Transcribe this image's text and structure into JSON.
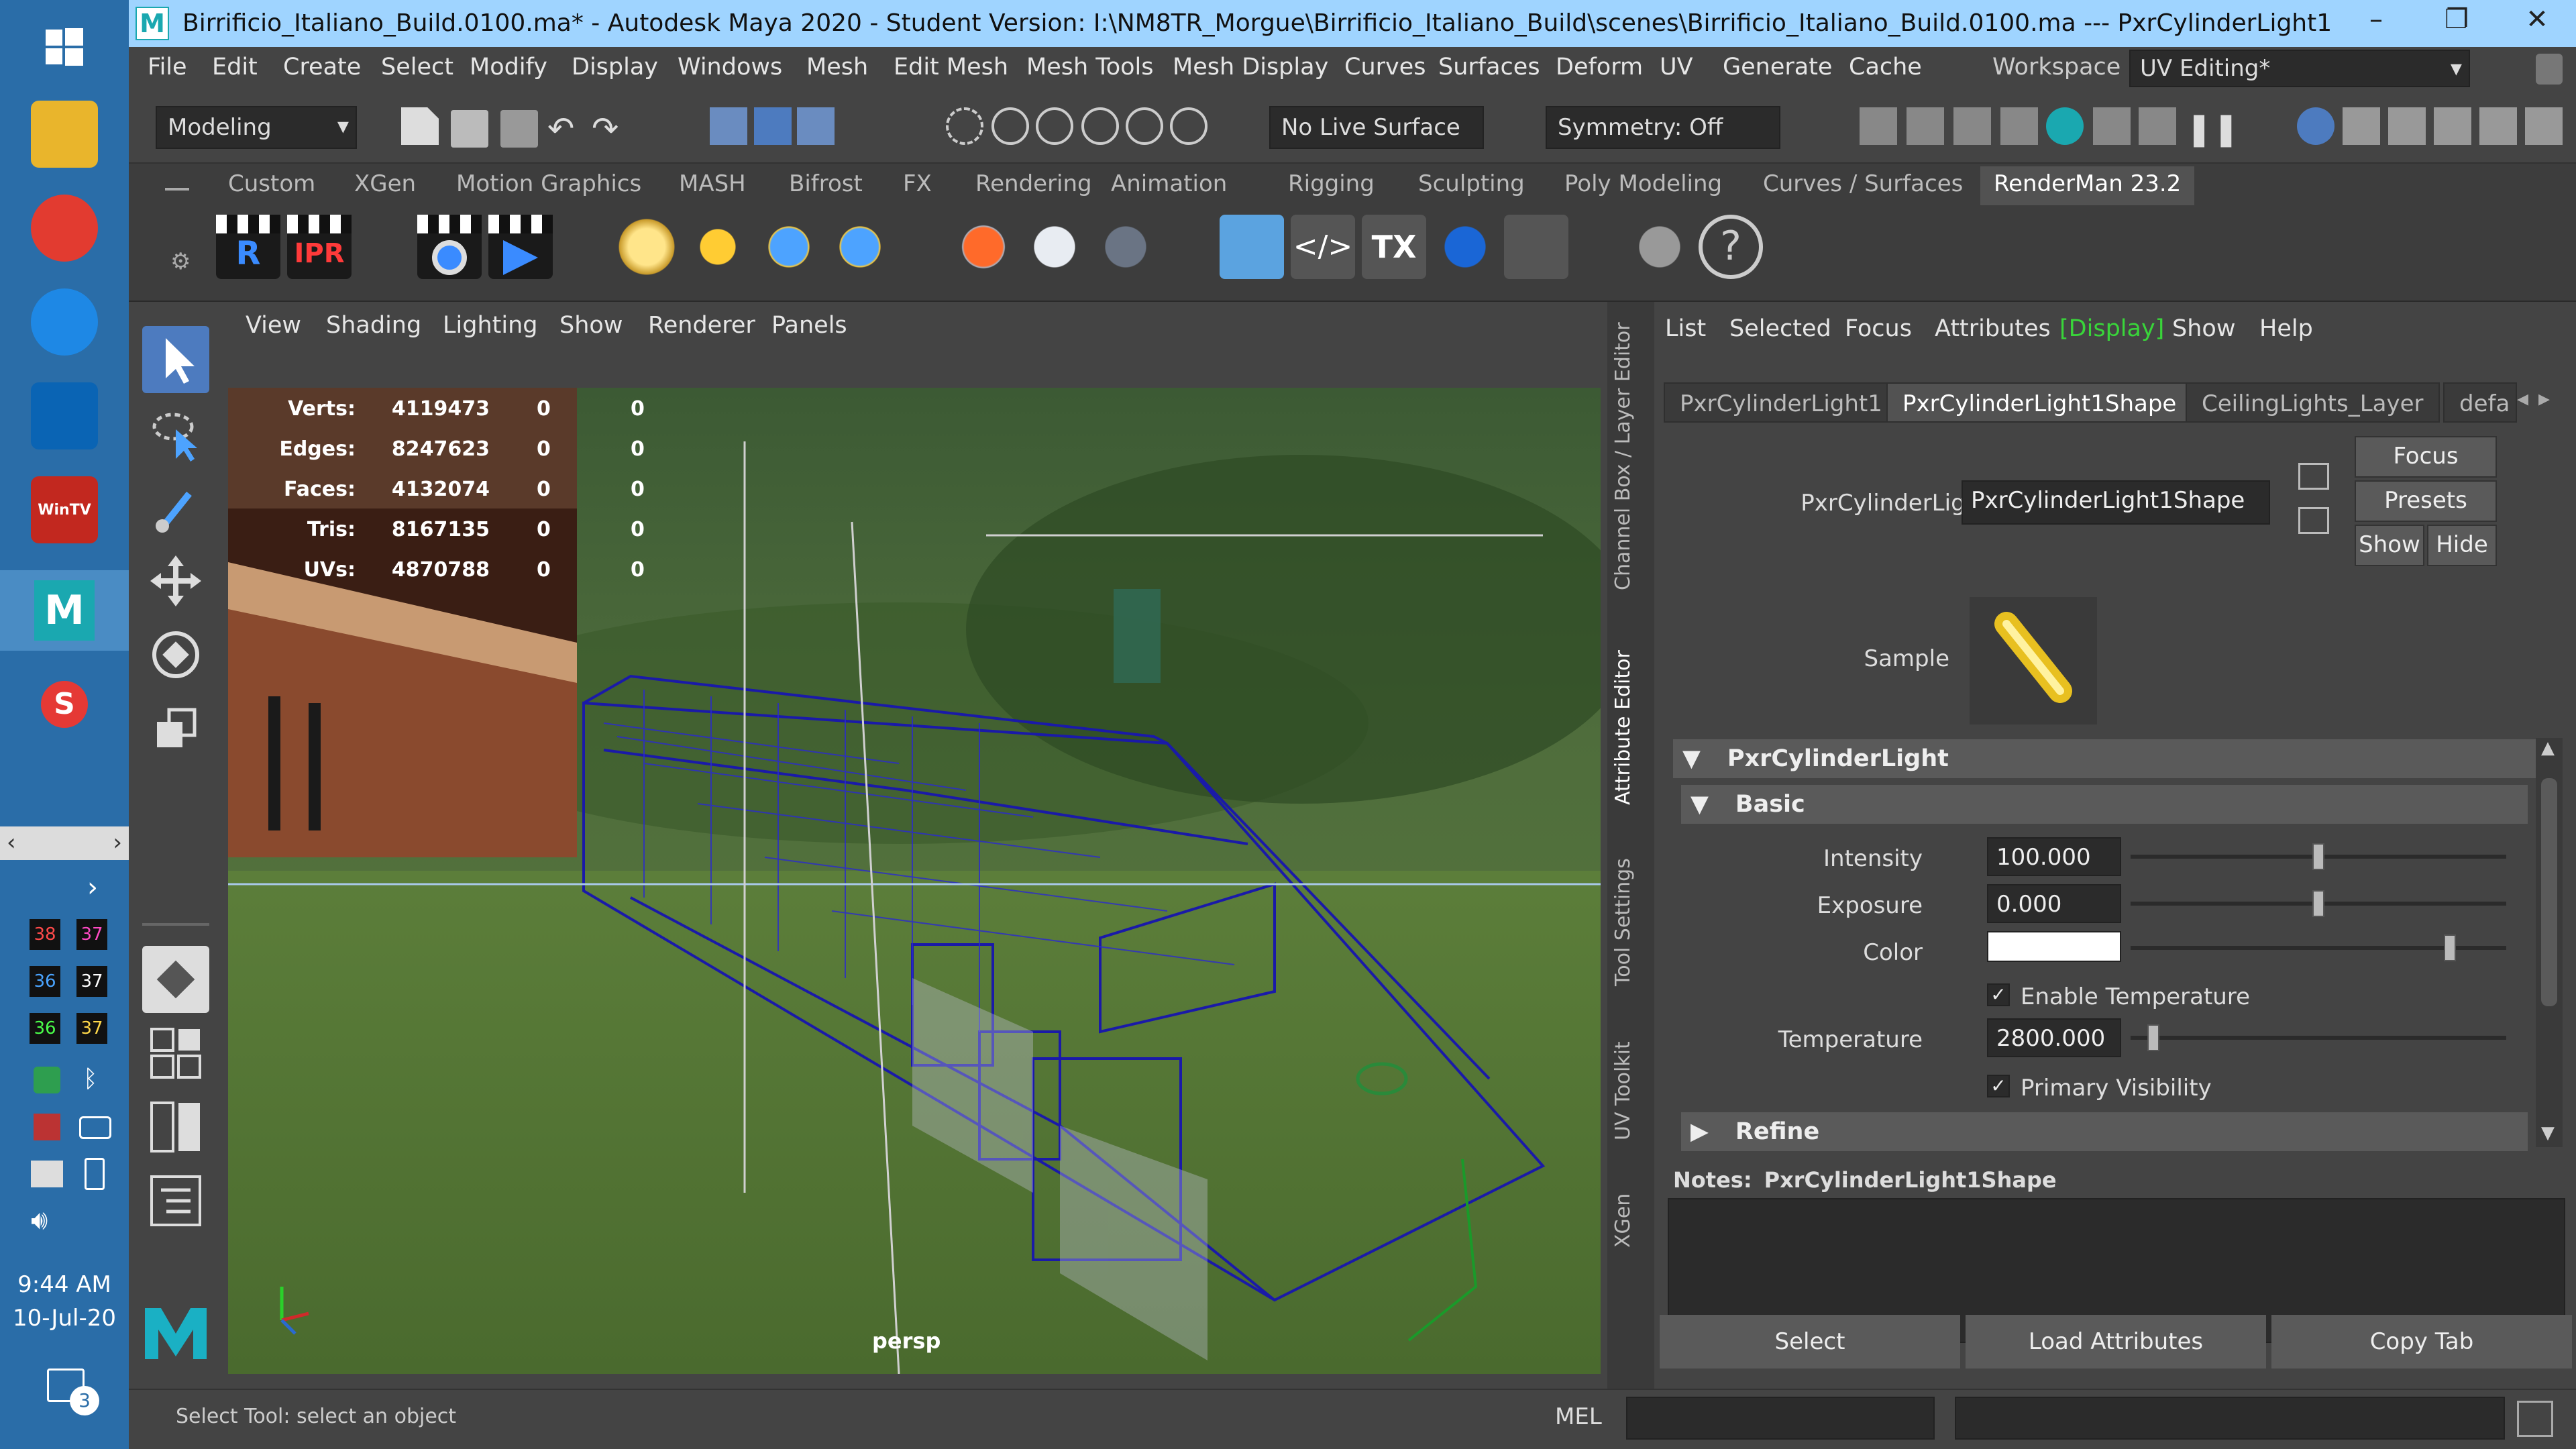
{
  "window": {
    "title": "Birrificio_Italiano_Build.0100.ma* - Autodesk Maya 2020 - Student Version: I:\\NM8TR_Morgue\\Birrificio_Italiano_Build\\scenes\\Birrificio_Italiano_Build.0100.ma   ---   PxrCylinderLight1",
    "app_icon": "M"
  },
  "menubar": {
    "items": [
      "File",
      "Edit",
      "Create",
      "Select",
      "Modify",
      "Display",
      "Windows",
      "Mesh",
      "Edit Mesh",
      "Mesh Tools",
      "Mesh Display",
      "Curves",
      "Surfaces",
      "Deform",
      "UV",
      "Generate",
      "Cache"
    ],
    "workspace_label": "Workspace :",
    "workspace_value": "UV Editing*"
  },
  "statusline": {
    "menuset": "Modeling",
    "live_surface": "No Live Surface",
    "symmetry": "Symmetry: Off"
  },
  "shelf": {
    "tabs": [
      "Custom",
      "XGen",
      "Motion Graphics",
      "MASH",
      "Bifrost",
      "FX",
      "Rendering",
      "Animation",
      "Rigging",
      "Sculpting",
      "Poly Modeling",
      "Curves / Surfaces",
      "RenderMan 23.2"
    ],
    "active_tab": "RenderMan 23.2",
    "button_labels": {
      "render": "R",
      "ipr": "IPR",
      "tx": "TX",
      "code": "</>"
    }
  },
  "viewport": {
    "menus": [
      "View",
      "Shading",
      "Lighting",
      "Show",
      "Renderer",
      "Panels"
    ],
    "camera": "persp",
    "hud": {
      "rows": [
        {
          "label": "Verts:",
          "v1": "4119473",
          "v2": "0",
          "v3": "0"
        },
        {
          "label": "Edges:",
          "v1": "8247623",
          "v2": "0",
          "v3": "0"
        },
        {
          "label": "Faces:",
          "v1": "4132074",
          "v2": "0",
          "v3": "0"
        },
        {
          "label": "Tris:",
          "v1": "8167135",
          "v2": "0",
          "v3": "0"
        },
        {
          "label": "UVs:",
          "v1": "4870788",
          "v2": "0",
          "v3": "0"
        }
      ]
    }
  },
  "side_tabs": [
    "Channel Box / Layer Editor",
    "Attribute Editor",
    "Tool Settings",
    "UV Toolkit",
    "XGen"
  ],
  "attribute_editor": {
    "menus": [
      "List",
      "Selected",
      "Focus",
      "Attributes",
      "[Display]",
      "Show",
      "Help"
    ],
    "tabs": [
      "PxrCylinderLight1",
      "PxrCylinderLight1Shape",
      "CeilingLights_Layer",
      "defa"
    ],
    "active_tab": "PxrCylinderLight1Shape",
    "node_label": "PxrCylinderLight:",
    "node_value": "PxrCylinderLight1Shape",
    "side_buttons": {
      "focus": "Focus",
      "presets": "Presets",
      "show": "Show",
      "hide": "Hide"
    },
    "sample_label": "Sample",
    "section_main": "PxrCylinderLight",
    "section_basic": "Basic",
    "section_refine": "Refine",
    "attrs": {
      "intensity_label": "Intensity",
      "intensity_value": "100.000",
      "intensity_slider": 0.5,
      "exposure_label": "Exposure",
      "exposure_value": "0.000",
      "exposure_slider": 0.5,
      "color_label": "Color",
      "color_value": "#ffffff",
      "color_slider": 0.85,
      "enable_temp_label": "Enable Temperature",
      "enable_temp_checked": true,
      "temperature_label": "Temperature",
      "temperature_value": "2800.000",
      "temperature_slider": 0.06,
      "primary_vis_label": "Primary Visibility",
      "primary_vis_checked": true
    },
    "notes_label": "Notes:",
    "notes_value": "PxrCylinderLight1Shape",
    "bottom_buttons": [
      "Select",
      "Load Attributes",
      "Copy Tab"
    ]
  },
  "helpline": {
    "text": "Select Tool: select an object",
    "cmd_lang": "MEL"
  },
  "taskbar": {
    "time": "9:44 AM",
    "date": "10-Jul-20",
    "notifications": "3",
    "badges": [
      "38",
      "37",
      "36",
      "37",
      "36",
      "37"
    ]
  },
  "colors": {
    "maya_bg": "#444444",
    "title_bg": "#9fd4ff",
    "taskbar_bg": "#2a6da8",
    "wire_blue": "#1a1aa8",
    "active_display": "#39d53a"
  }
}
